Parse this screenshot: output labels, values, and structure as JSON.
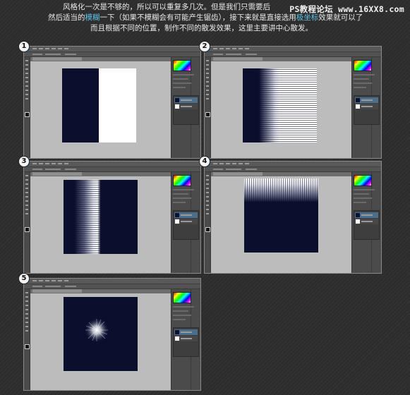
{
  "intro": {
    "line1": "风格化一次是不够的，所以可以重复多几次。但是我们只需要后",
    "line2a": "然后适当的",
    "line2b": "模糊",
    "line2c": "一下（如果不模糊会有可能产生锯齿），接下来就是直接选用",
    "line2d": "极坐标",
    "line2e": "效果就可以了",
    "line3": "而且根据不同的位置，制作不同的散发效果，这里主要讲中心散发。"
  },
  "watermark": "PS教程论坛 www.16XX8.com",
  "colors": {
    "navy": "#0b0f2e",
    "highlight": "#59c5e8",
    "workspace": "#bcbcbc"
  },
  "steps": [
    {
      "number": "1",
      "state": "split canvas: navy left, white right"
    },
    {
      "number": "2",
      "state": "wind streaks from the navy edge into white"
    },
    {
      "number": "3",
      "state": "streaks reversed, white fading into navy"
    },
    {
      "number": "4",
      "state": "canvas rotated: white streaks along top over navy"
    },
    {
      "number": "5",
      "state": "polar coordinates applied: white center burst on navy"
    }
  ]
}
